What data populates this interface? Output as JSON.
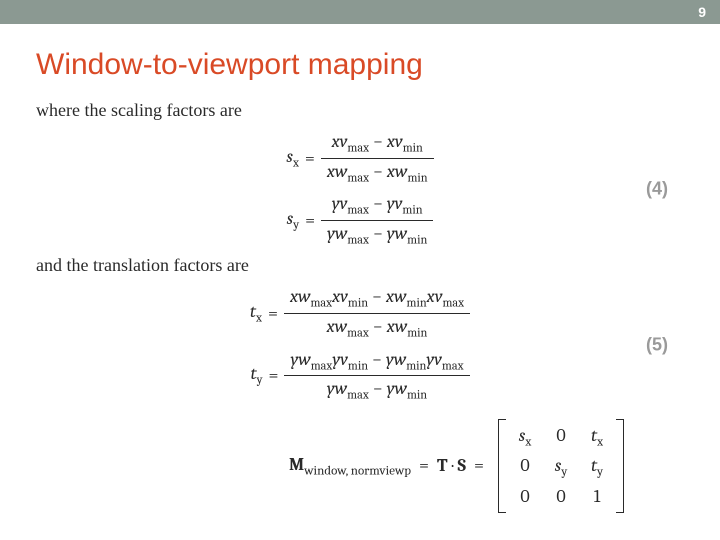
{
  "slide_number": "9",
  "title": "Window-to-viewport mapping",
  "text1": "where the scaling factors are",
  "text2": "and the translation factors are",
  "eq4": {
    "num": "(4)",
    "sx": {
      "lhs": "s",
      "lhs_sub": "x",
      "num_a": "xv",
      "num_a_sub": "max",
      "num_b": "xv",
      "num_b_sub": "min",
      "den_a": "xw",
      "den_a_sub": "max",
      "den_b": "xw",
      "den_b_sub": "min"
    },
    "sy": {
      "lhs": "s",
      "lhs_sub": "y",
      "num_a": "yv",
      "num_a_sub": "max",
      "num_b": "yv",
      "num_b_sub": "min",
      "den_a": "yw",
      "den_a_sub": "max",
      "den_b": "yw",
      "den_b_sub": "min"
    }
  },
  "eq5": {
    "num": "(5)",
    "tx": {
      "lhs": "t",
      "lhs_sub": "x",
      "n1": "xw",
      "n1s": "max",
      "n2": "xv",
      "n2s": "min",
      "n3": "xw",
      "n3s": "min",
      "n4": "xv",
      "n4s": "max",
      "d1": "xw",
      "d1s": "max",
      "d2": "xw",
      "d2s": "min"
    },
    "ty": {
      "lhs": "t",
      "lhs_sub": "y",
      "n1": "yw",
      "n1s": "max",
      "n2": "yv",
      "n2s": "min",
      "n3": "yw",
      "n3s": "min",
      "n4": "yv",
      "n4s": "max",
      "d1": "yw",
      "d1s": "max",
      "d2": "yw",
      "d2s": "min"
    }
  },
  "matrix": {
    "M": "M",
    "M_sub": "window, normviewp",
    "T": "T",
    "dot": "·",
    "S": "S",
    "c11": "s",
    "c11s": "x",
    "c12": "0",
    "c13": "t",
    "c13s": "x",
    "c21": "0",
    "c22": "s",
    "c22s": "y",
    "c23": "t",
    "c23s": "y",
    "c31": "0",
    "c32": "0",
    "c33": "1"
  },
  "minus": "−",
  "equals": "="
}
